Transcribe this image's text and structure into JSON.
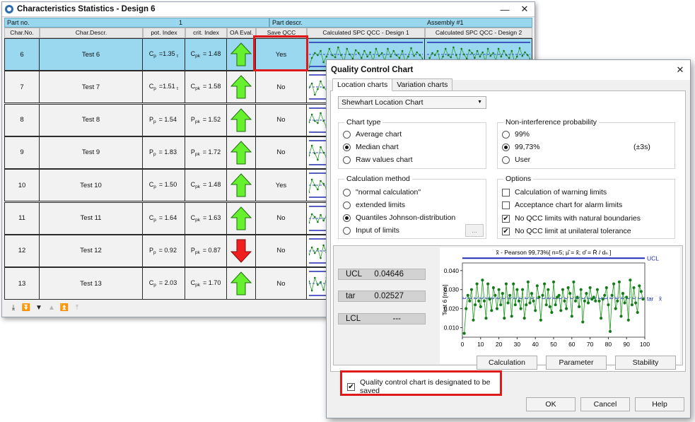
{
  "main": {
    "title": "Characteristics Statistics - Design 6",
    "part_no_label": "Part no.",
    "part_no_value": "1",
    "part_descr_label": "Part descr.",
    "part_descr_value": "Assembly #1",
    "columns": [
      "Char.No.",
      "Char.Descr.",
      "pot. Index",
      "crit. Index",
      "OA Eval.",
      "Save QCC",
      "Calculated SPC QCC - Design 1",
      "Calculated SPC QCC - Design 2"
    ],
    "rows": [
      {
        "no": "6",
        "descr": "Test 6",
        "pot_sym": "C",
        "pot_sub": "p",
        "pot_val": "=1.35",
        "pot_suffix": "τ",
        "crit_sym": "C",
        "crit_sub": "pk",
        "crit_val": "= 1.48",
        "eval": "up",
        "save": "Yes"
      },
      {
        "no": "7",
        "descr": "Test 7",
        "pot_sym": "C",
        "pot_sub": "p",
        "pot_val": "=1.51",
        "pot_suffix": "τ",
        "crit_sym": "C",
        "crit_sub": "pk",
        "crit_val": "= 1.58",
        "eval": "up",
        "save": "No"
      },
      {
        "no": "8",
        "descr": "Test 8",
        "pot_sym": "P",
        "pot_sub": "p",
        "pot_val": "= 1.54",
        "pot_suffix": "",
        "crit_sym": "P",
        "crit_sub": "pk",
        "crit_val": "= 1.52",
        "eval": "up",
        "save": "No"
      },
      {
        "no": "9",
        "descr": "Test 9",
        "pot_sym": "P",
        "pot_sub": "p",
        "pot_val": "= 1.83",
        "pot_suffix": "",
        "crit_sym": "P",
        "crit_sub": "pk",
        "crit_val": "= 1.72",
        "eval": "up",
        "save": "No"
      },
      {
        "no": "10",
        "descr": "Test 10",
        "pot_sym": "C",
        "pot_sub": "p",
        "pot_val": "= 1.50",
        "pot_suffix": "",
        "crit_sym": "C",
        "crit_sub": "pk",
        "crit_val": "= 1.48",
        "eval": "up",
        "save": "Yes"
      },
      {
        "no": "11",
        "descr": "Test 11",
        "pot_sym": "C",
        "pot_sub": "p",
        "pot_val": "= 1.64",
        "pot_suffix": "",
        "crit_sym": "C",
        "crit_sub": "pk",
        "crit_val": "= 1.63",
        "eval": "up",
        "save": "No"
      },
      {
        "no": "12",
        "descr": "Test 12",
        "pot_sym": "P",
        "pot_sub": "p",
        "pot_val": "= 0.92",
        "pot_suffix": "",
        "crit_sym": "P",
        "crit_sub": "pk",
        "crit_val": "= 0.87",
        "eval": "down",
        "save": "No"
      },
      {
        "no": "13",
        "descr": "Test 13",
        "pot_sym": "C",
        "pot_sub": "p",
        "pot_val": "= 2.03",
        "pot_suffix": "",
        "crit_sym": "C",
        "crit_sub": "pk",
        "crit_val": "= 1.70",
        "eval": "up",
        "save": "No"
      }
    ],
    "toolbar_icons": [
      "first-icon",
      "down-fast-icon",
      "down-icon",
      "up-icon",
      "up-fast-icon",
      "top-icon"
    ]
  },
  "dialog": {
    "title": "Quality Control Chart",
    "tabs": [
      "Location charts",
      "Variation charts"
    ],
    "chart_select": "Shewhart Location Chart",
    "chart_type_title": "Chart type",
    "chart_type_options": [
      "Average chart",
      "Median chart",
      "Raw values chart"
    ],
    "nonint_title": "Non-interference probability",
    "nonint_options": [
      "99%",
      "99,73%",
      "User"
    ],
    "nonint_note": "(±3s)",
    "calc_title": "Calculation method",
    "calc_options": [
      "\"normal calculation\"",
      "extended limits",
      "Quantiles Johnson-distribution",
      "Input of limits"
    ],
    "calc_more_button": "...",
    "options_title": "Options",
    "options": [
      "Calculation of warning limits",
      "Acceptance chart for alarm limits",
      "No QCC limits with natural boundaries",
      "No QCC limit at unilateral tolerance"
    ],
    "options_checked": [
      false,
      false,
      true,
      true
    ],
    "ucl_label": "UCL",
    "ucl_value": "0.04646",
    "tar_label": "tar",
    "tar_value": "0.02527",
    "lcl_label": "LCL",
    "lcl_value": "---",
    "buttons": {
      "calculation": "Calculation",
      "parameter": "Parameter",
      "stability": "Stability",
      "ok": "OK",
      "cancel": "Cancel",
      "help": "Help"
    },
    "save_label": "Quality control chart is designated to be saved"
  },
  "chart_data": {
    "type": "line",
    "title": "x̃ - Pearson 99,73%[ n=5;  µ̂ = x̃;  σ̂ = R̄ / dₙ ]",
    "xlabel": "",
    "ylabel": "Test 6 [mm]",
    "xlim": [
      0,
      100
    ],
    "ylim": [
      0.005,
      0.044
    ],
    "xticks": [
      "0",
      "10",
      "20",
      "30",
      "40",
      "50",
      "60",
      "70",
      "80",
      "90",
      "100"
    ],
    "yticks": [
      "0.010",
      "0.020",
      "0.030",
      "0.040"
    ],
    "ucl": 0.0465,
    "tar": 0.0253,
    "limit_labels": {
      "ucl": "UCL",
      "tar": "tar",
      "center": "x̃"
    },
    "x": [
      1,
      2,
      3,
      4,
      5,
      6,
      7,
      8,
      9,
      10,
      11,
      12,
      13,
      14,
      15,
      16,
      17,
      18,
      19,
      20,
      21,
      22,
      23,
      24,
      25,
      26,
      27,
      28,
      29,
      30,
      31,
      32,
      33,
      34,
      35,
      36,
      37,
      38,
      39,
      40,
      41,
      42,
      43,
      44,
      45,
      46,
      47,
      48,
      49,
      50,
      51,
      52,
      53,
      54,
      55,
      56,
      57,
      58,
      59,
      60,
      61,
      62,
      63,
      64,
      65,
      66,
      67,
      68,
      69,
      70,
      71,
      72,
      73,
      74,
      75,
      76,
      77,
      78,
      79,
      80,
      81,
      82,
      83,
      84,
      85,
      86,
      87,
      88,
      89,
      90,
      91,
      92,
      93,
      94,
      95,
      96,
      97,
      98,
      99
    ],
    "series": [
      {
        "values": [
          0.007,
          0.02,
          0.027,
          0.024,
          0.03,
          0.014,
          0.022,
          0.033,
          0.024,
          0.021,
          0.035,
          0.024,
          0.015,
          0.033,
          0.025,
          0.019,
          0.031,
          0.027,
          0.02,
          0.03,
          0.022,
          0.028,
          0.015,
          0.033,
          0.023,
          0.027,
          0.016,
          0.033,
          0.022,
          0.03,
          0.024,
          0.02,
          0.03,
          0.015,
          0.022,
          0.034,
          0.023,
          0.028,
          0.024,
          0.019,
          0.032,
          0.026,
          0.014,
          0.027,
          0.033,
          0.022,
          0.03,
          0.021,
          0.018,
          0.034,
          0.022,
          0.026,
          0.027,
          0.019,
          0.03,
          0.024,
          0.02,
          0.031,
          0.028,
          0.016,
          0.034,
          0.024,
          0.026,
          0.021,
          0.03,
          0.013,
          0.024,
          0.028,
          0.023,
          0.031,
          0.025,
          0.026,
          0.024,
          0.03,
          0.024,
          0.015,
          0.025,
          0.027,
          0.031,
          0.022,
          0.008,
          0.027,
          0.033,
          0.02,
          0.024,
          0.034,
          0.016,
          0.028,
          0.023,
          0.026,
          0.014,
          0.035,
          0.022,
          0.031,
          0.023,
          0.018,
          0.032,
          0.029,
          0.025
        ]
      }
    ]
  }
}
